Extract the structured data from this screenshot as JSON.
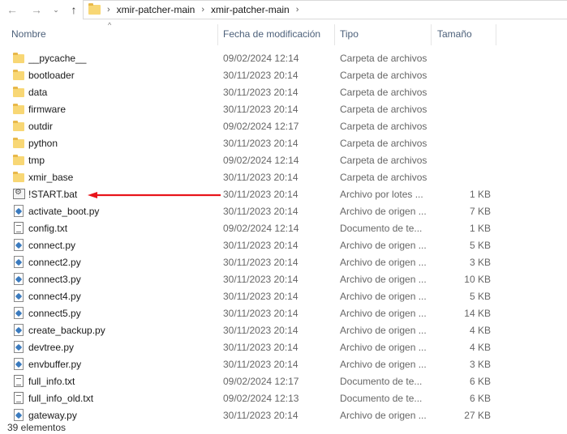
{
  "breadcrumb": [
    "xmir-patcher-main",
    "xmir-patcher-main"
  ],
  "nav": {
    "back": "←",
    "forward": "→",
    "recent": "⌄",
    "up": "↑"
  },
  "columns": {
    "name": "Nombre",
    "date": "Fecha de modificación",
    "type": "Tipo",
    "size": "Tamaño"
  },
  "files": [
    {
      "name": "__pycache__",
      "date": "09/02/2024 12:14",
      "type": "Carpeta de archivos",
      "size": "",
      "icon": "folder-icon"
    },
    {
      "name": "bootloader",
      "date": "30/11/2023 20:14",
      "type": "Carpeta de archivos",
      "size": "",
      "icon": "folder-icon"
    },
    {
      "name": "data",
      "date": "30/11/2023 20:14",
      "type": "Carpeta de archivos",
      "size": "",
      "icon": "folder-icon"
    },
    {
      "name": "firmware",
      "date": "30/11/2023 20:14",
      "type": "Carpeta de archivos",
      "size": "",
      "icon": "folder-icon"
    },
    {
      "name": "outdir",
      "date": "09/02/2024 12:17",
      "type": "Carpeta de archivos",
      "size": "",
      "icon": "folder-icon"
    },
    {
      "name": "python",
      "date": "30/11/2023 20:14",
      "type": "Carpeta de archivos",
      "size": "",
      "icon": "folder-icon"
    },
    {
      "name": "tmp",
      "date": "09/02/2024 12:14",
      "type": "Carpeta de archivos",
      "size": "",
      "icon": "folder-icon"
    },
    {
      "name": "xmir_base",
      "date": "30/11/2023 20:14",
      "type": "Carpeta de archivos",
      "size": "",
      "icon": "folder-icon"
    },
    {
      "name": "!START.bat",
      "date": "30/11/2023 20:14",
      "type": "Archivo por lotes ...",
      "size": "1 KB",
      "icon": "batch-file-icon"
    },
    {
      "name": "activate_boot.py",
      "date": "30/11/2023 20:14",
      "type": "Archivo de origen ...",
      "size": "7 KB",
      "icon": "python-file-icon"
    },
    {
      "name": "config.txt",
      "date": "09/02/2024 12:14",
      "type": "Documento de te...",
      "size": "1 KB",
      "icon": "text-file-icon"
    },
    {
      "name": "connect.py",
      "date": "30/11/2023 20:14",
      "type": "Archivo de origen ...",
      "size": "5 KB",
      "icon": "python-file-icon"
    },
    {
      "name": "connect2.py",
      "date": "30/11/2023 20:14",
      "type": "Archivo de origen ...",
      "size": "3 KB",
      "icon": "python-file-icon"
    },
    {
      "name": "connect3.py",
      "date": "30/11/2023 20:14",
      "type": "Archivo de origen ...",
      "size": "10 KB",
      "icon": "python-file-icon"
    },
    {
      "name": "connect4.py",
      "date": "30/11/2023 20:14",
      "type": "Archivo de origen ...",
      "size": "5 KB",
      "icon": "python-file-icon"
    },
    {
      "name": "connect5.py",
      "date": "30/11/2023 20:14",
      "type": "Archivo de origen ...",
      "size": "14 KB",
      "icon": "python-file-icon"
    },
    {
      "name": "create_backup.py",
      "date": "30/11/2023 20:14",
      "type": "Archivo de origen ...",
      "size": "4 KB",
      "icon": "python-file-icon"
    },
    {
      "name": "devtree.py",
      "date": "30/11/2023 20:14",
      "type": "Archivo de origen ...",
      "size": "4 KB",
      "icon": "python-file-icon"
    },
    {
      "name": "envbuffer.py",
      "date": "30/11/2023 20:14",
      "type": "Archivo de origen ...",
      "size": "3 KB",
      "icon": "python-file-icon"
    },
    {
      "name": "full_info.txt",
      "date": "09/02/2024 12:17",
      "type": "Documento de te...",
      "size": "6 KB",
      "icon": "text-file-icon"
    },
    {
      "name": "full_info_old.txt",
      "date": "09/02/2024 12:13",
      "type": "Documento de te...",
      "size": "6 KB",
      "icon": "text-file-icon"
    },
    {
      "name": "gateway.py",
      "date": "30/11/2023 20:14",
      "type": "Archivo de origen ...",
      "size": "27 KB",
      "icon": "python-file-icon"
    }
  ],
  "status": {
    "count": "39 elementos"
  },
  "colors": {
    "arrow": "#e8141b",
    "header_text": "#4c607a",
    "folder": "#f8d775"
  }
}
